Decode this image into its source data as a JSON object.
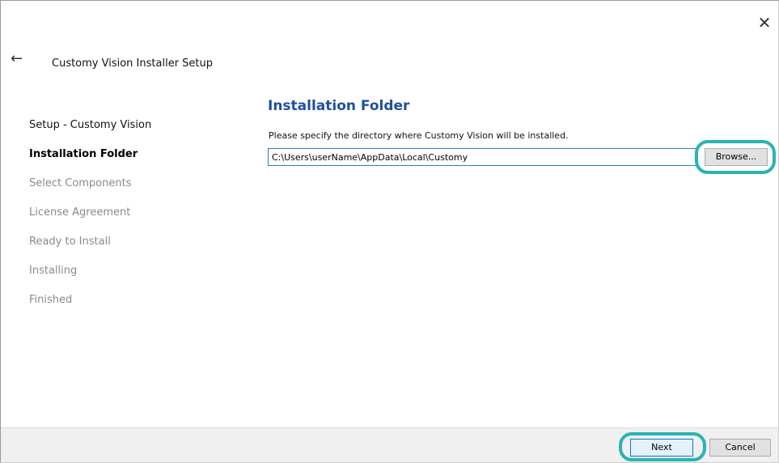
{
  "window": {
    "title": "Customy Vision Installer Setup",
    "close_glyph": "✕",
    "back_glyph": "←"
  },
  "sidebar": {
    "steps": [
      {
        "label": "Setup - Customy Vision",
        "state": "done"
      },
      {
        "label": "Installation Folder",
        "state": "current"
      },
      {
        "label": "Select Components",
        "state": "pending"
      },
      {
        "label": "License Agreement",
        "state": "pending"
      },
      {
        "label": "Ready to Install",
        "state": "pending"
      },
      {
        "label": "Installing",
        "state": "pending"
      },
      {
        "label": "Finished",
        "state": "pending"
      }
    ]
  },
  "main": {
    "heading": "Installation Folder",
    "instruction": "Please specify the directory where Customy Vision will be installed.",
    "path_value": "C:\\Users\\userName\\AppData\\Local\\Customy",
    "browse_label": "Browse..."
  },
  "footer": {
    "next_label": "Next",
    "cancel_label": "Cancel"
  },
  "colors": {
    "heading": "#1e4fa0",
    "highlight_ring": "#2ab3b3",
    "input_border": "#2a78d6"
  },
  "icons": {
    "close": "close-icon",
    "back": "back-arrow-icon"
  }
}
